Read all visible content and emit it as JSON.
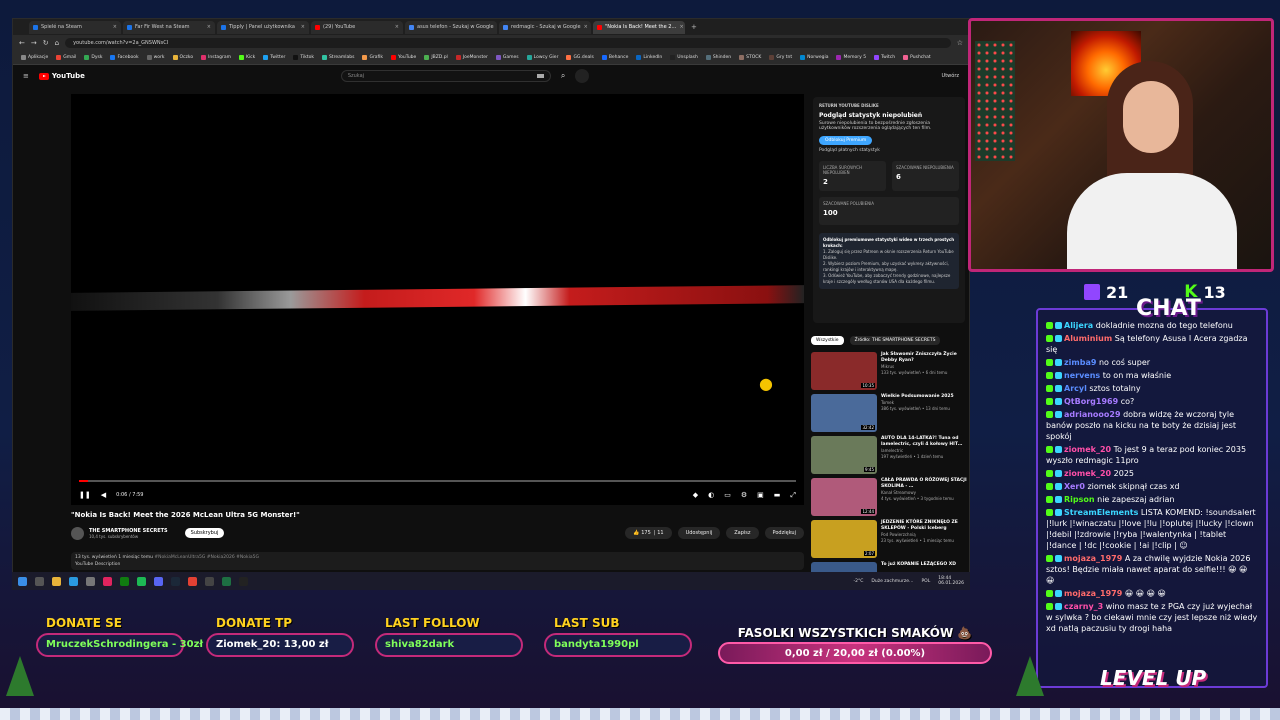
{
  "browser": {
    "tabs": [
      {
        "label": "Spielé na Steam",
        "color": "#1b73e8"
      },
      {
        "label": "Far Fir West na Steam",
        "color": "#1b73e8"
      },
      {
        "label": "Tipply | Panel użytkownika",
        "color": "#1b73e8"
      },
      {
        "label": "(29) YouTube",
        "color": "#ff0000"
      },
      {
        "label": "asus telefon - Szukaj w Google",
        "color": "#4285f4"
      },
      {
        "label": "redmagic - Szukaj w Google",
        "color": "#4285f4"
      },
      {
        "label": "\"Nokia Is Back! Meet the 2…",
        "color": "#ff0000"
      }
    ],
    "url": "youtube.com/watch?v=2a_GNSWNsCI",
    "bookmarks": [
      "Aplikacje",
      "Gmail",
      "Dysk",
      "Facebook",
      "work",
      "Oczko",
      "Instagram",
      "Kick",
      "Twitter",
      "Tiktok",
      "Streamlabs",
      "Grafik",
      "YouTube",
      "JBZD.pl",
      "JoeMonster",
      "Games",
      "Lowcy Gier",
      "GG.deals",
      "Behance",
      "LinkedIn",
      "Unsplash",
      "Shinden",
      "STOCK",
      "Gry tnt",
      "Norwegia",
      "Memory 5",
      "Twitch",
      "Pushchat"
    ]
  },
  "youtube": {
    "logo": "YouTube",
    "search_placeholder": "Szukaj",
    "create": "Utwórz",
    "video": {
      "time": "0:06 / 7:59",
      "progress": 0.013,
      "title": "\"Nokia Is Back! Meet the 2026 McLean Ultra 5G Monster!\"",
      "channel": "THE SMARTPHONE SECRETS",
      "subscribers": "10,4 tys. subskrybentów",
      "subscribe": "Subskrybuj",
      "likes": "175",
      "dislikes": "11",
      "share": "Udostępnij",
      "save": "Zapisz",
      "thanks": "Podziękuj",
      "desc_stats": "13 tys. wyświetleń  1 miesiąc temu",
      "desc_tags": "#NokiaMcLeanUltra5G #Nokia2026 #Nokia5G",
      "desc_text": "YouTube Description"
    },
    "dislike_panel": {
      "header": "RETURN YOUTUBE DISLIKE",
      "title": "Podgląd statystyk niepolubień",
      "text": "Surowe niepolubienia to bezpośrednie zgłoszenia użytkowników rozszerzenia oglądających ten film.",
      "button": "Odblokuj Premium",
      "sub": "Podgląd płatnych statystyk",
      "stats": [
        {
          "label": "LICZBA SUROWYCH NIEPOLUBIEŃ",
          "value": "2"
        },
        {
          "label": "SZACOWANE NIEPOLUBIENIA",
          "value": "6"
        }
      ],
      "likes_label": "SZACOWANE POLUBIENIA",
      "likes_value": "100",
      "promo_title": "Odblokuj premiumowe statystyki wideo w trzech prostych krokach:",
      "promo_1": "1. Zaloguj się przez Patreon w oknie rozszerzenia Return YouTube Dislike.",
      "promo_2": "2. Wybierz poziom Premium, aby uzyskać wykresy aktywności, rankingi krajów i interaktywną mapę.",
      "promo_3": "3. Odśwież YouTube, aby zobaczyć trendy godzinowe, najlepsze kraje i szczegóły według stanów USA dla każdego filmu."
    },
    "chips": [
      "Wszystkie",
      "Źródło: THE SMARTPHONE SECRETS"
    ],
    "recommended": [
      {
        "title": "Jak Sławomir Zniszczyła Życie Debby Ryan?",
        "channel": "Mikrus",
        "meta": "133 tys. wyświetleń • 6 dni temu",
        "dur": "10:35",
        "color": "#8a2a2a"
      },
      {
        "title": "Wielkie Podsumowanie 2025",
        "channel": "Tomek",
        "meta": "386 tys. wyświetleń • 13 dni temu",
        "dur": "32:42",
        "color": "#4a6a9a"
      },
      {
        "title": "AUTO DLA 14-LATKA?! Tuna od lamelectric, czyli 4 kołowy HIT…",
        "channel": "lamelectric",
        "meta": "197 wyświetleń • 1 dzień temu",
        "dur": "9:45",
        "color": "#6a7a5a"
      },
      {
        "title": "CAŁA PRAWDA O RÓŻOWEJ STACJI SKOLIMA - …",
        "channel": "Kanał Streamowy",
        "meta": "4 tys. wyświetleń • 3 tygodnie temu",
        "dur": "12:44",
        "color": "#b05a7a"
      },
      {
        "title": "JEDZENIE KTÓRE ZNIKNĘŁO ZE SKLEPÓW - Polski Iceberg",
        "channel": "Pod Powierzchnią",
        "meta": "23 tys. wyświetleń • 1 miesiąc temu",
        "dur": "2:07",
        "color": "#c8a020"
      },
      {
        "title": "To już KOPANIE LEŻĄCEGO XD",
        "channel": "",
        "meta": "",
        "dur": "",
        "color": "#3a5a8a"
      }
    ]
  },
  "taskbar": {
    "weather": "-2°C",
    "weather_desc": "Duże zachmurze…",
    "lang": "POL",
    "time": "18:44",
    "date": "06.01.2026"
  },
  "counters": {
    "twitch": "21",
    "kick": "13"
  },
  "chat": {
    "title": "CHAT",
    "messages": [
      {
        "user": "Alijera",
        "text": "dokladnie mozna do tego telefonu",
        "color": "#3bd6ff"
      },
      {
        "user": "Aluminium",
        "text": "Są telefony Asusa I Acera zgadza się",
        "color": "#ff6b6b"
      },
      {
        "user": "zimba9",
        "text": "no coś super",
        "color": "#5a8dff"
      },
      {
        "user": "nervens",
        "text": "to on ma właśnie",
        "color": "#5a8dff"
      },
      {
        "user": "Arcyl",
        "text": "sztos totalny",
        "color": "#5a8dff"
      },
      {
        "user": "QtBorg1969",
        "text": "co?",
        "color": "#a67bff"
      },
      {
        "user": "adrianooo29",
        "text": "dobra widzę że wczoraj tyle banów poszło na kicku na te boty że dzisiaj jest spokój",
        "color": "#a67bff"
      },
      {
        "user": "ziomek_20",
        "text": "To jest 9 a teraz pod koniec 2035 wyszło redmagic 11pro",
        "color": "#ff4fa8"
      },
      {
        "user": "ziomek_20",
        "text": "2025",
        "color": "#ff4fa8"
      },
      {
        "user": "Xer0",
        "text": "ziomek skipnął czas xd",
        "color": "#a67bff"
      },
      {
        "user": "Ripson",
        "text": "nie zapeszaj adrian",
        "color": "#53fc18"
      },
      {
        "user": "StreamElements",
        "text": "LISTA KOMEND: !soundsalert |!lurk |!winaczatu |!love |!lu |!oplutej |!lucky |!clown |!debil |!zdrowie |!ryba |!walentynka | !tablet |!dance | !dc |!cookie | !ai |!clip | ☺",
        "color": "#3bd6ff"
      },
      {
        "user": "mojaza_1979",
        "text": "A za chwilę wyjdzie Nokia 2026 sztos! Będzie miała nawet aparat do selfie!!! 😀 😀 😀",
        "color": "#ff6b6b"
      },
      {
        "user": "mojaza_1979",
        "text": "😀 😀 😀 😀",
        "color": "#ff6b6b"
      },
      {
        "user": "czarny_3",
        "text": "wino masz te z PGA czy już wyjechał w sylwka ? bo ciekawi mnie czy jest lepsze niż wiedy xd natlą paczusiu ty drogi haha",
        "color": "#ff4fa8"
      }
    ]
  },
  "overlay": {
    "donate_se_label": "DONATE SE",
    "donate_se_value": "MruczekSchrodingera - 30zł",
    "donate_tp_label": "DONATE TP",
    "donate_tp_value": "Ziomek_20: 13,00 zł",
    "last_follow_label": "LAST FOLLOW",
    "last_follow_value": "shiva82dark",
    "last_sub_label": "LAST SUB",
    "last_sub_value": "bandyta1990pl",
    "goal_title": "FASOLKI WSZYSTKICH SMAKÓW 💩",
    "goal_value": "0,00 zł / 20,00 zł (0.00%)",
    "goal_progress": 0,
    "logo": "LEVEL UP"
  }
}
